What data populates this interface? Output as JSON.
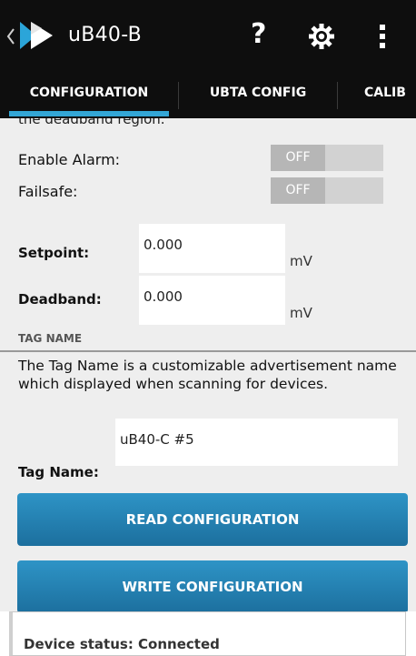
{
  "appbar": {
    "title": "uB40-B",
    "help_glyph": "?",
    "icons": [
      "back-chevron-icon",
      "app-logo-icon",
      "help-icon",
      "gear-icon",
      "overflow-menu-icon"
    ]
  },
  "tabs": [
    {
      "label": "CONFIGURATION",
      "active": true
    },
    {
      "label": "UBTA CONFIG",
      "active": false
    },
    {
      "label": "CALIB",
      "active": false
    }
  ],
  "form": {
    "cut_text": "the deadband region.",
    "enable_alarm": {
      "label": "Enable Alarm:",
      "state": "OFF"
    },
    "failsafe": {
      "label": "Failsafe:",
      "state": "OFF"
    },
    "setpoint": {
      "label": "Setpoint:",
      "value": "0.000",
      "unit": "mV"
    },
    "deadband": {
      "label": "Deadband:",
      "value": "0.000",
      "unit": "mV"
    }
  },
  "tag_section": {
    "header": "TAG NAME",
    "description": "The Tag Name is a customizable advertisement name which displayed when scanning for devices.",
    "label": "Tag Name:",
    "value": "uB40-C #5"
  },
  "buttons": {
    "read": "READ CONFIGURATION",
    "write": "WRITE CONFIGURATION"
  },
  "status": {
    "text": "Device status: Connected"
  },
  "colors": {
    "accent": "#33a6d6",
    "button": "#2581b5",
    "appbar": "#0e0e0e",
    "background": "#eeeeee"
  }
}
